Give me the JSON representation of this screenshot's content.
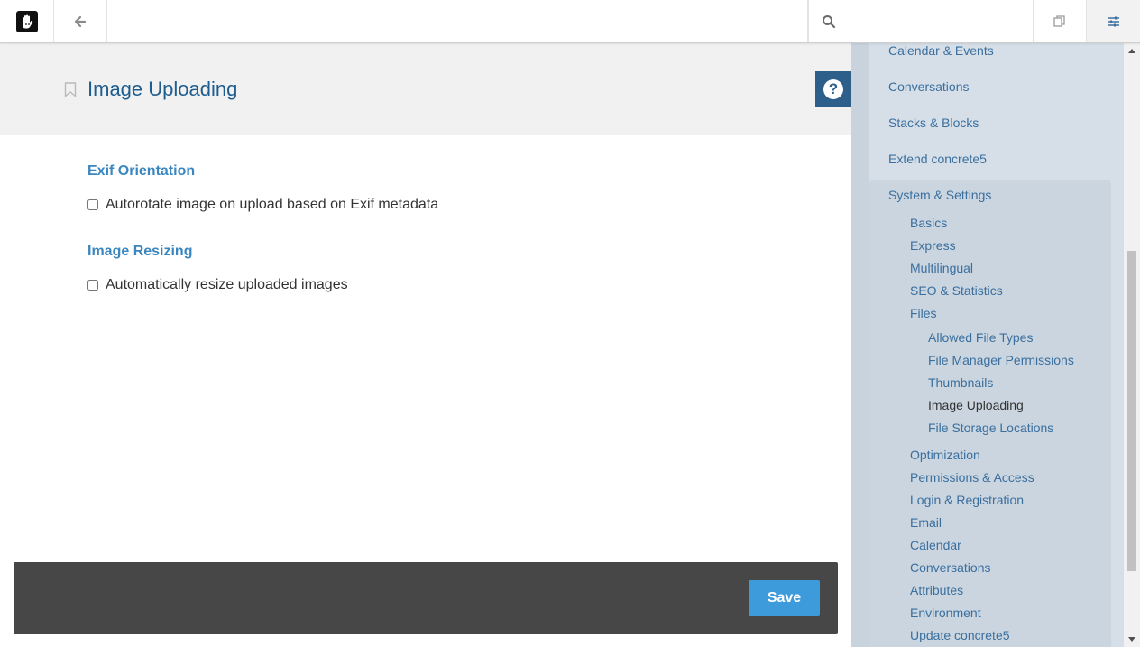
{
  "toolbar": {
    "search_placeholder": "",
    "search_value": ""
  },
  "page": {
    "title": "Image Uploading"
  },
  "sections": [
    {
      "heading": "Exif Orientation",
      "checkbox_label": "Autorotate image on upload based on Exif metadata",
      "checked": false
    },
    {
      "heading": "Image Resizing",
      "checkbox_label": "Automatically resize uploaded images",
      "checked": false
    }
  ],
  "footer": {
    "save_label": "Save"
  },
  "sidebar": {
    "top_items": [
      "Calendar & Events",
      "Conversations",
      "Stacks & Blocks",
      "Extend concrete5"
    ],
    "group_title": "System & Settings",
    "system_items": [
      "Basics",
      "Express",
      "Multilingual",
      "SEO & Statistics",
      "Files"
    ],
    "files_items": [
      "Allowed File Types",
      "File Manager Permissions",
      "Thumbnails",
      "Image Uploading",
      "File Storage Locations"
    ],
    "active_item": "Image Uploading",
    "more_items": [
      "Optimization",
      "Permissions & Access",
      "Login & Registration",
      "Email",
      "Calendar",
      "Conversations",
      "Attributes",
      "Environment",
      "Update concrete5"
    ]
  },
  "colors": {
    "title": "#1f5d8f",
    "section_heading": "#3a87c0",
    "help_button": "#2e5e8a",
    "save_button": "#3d9bdb",
    "sidebar_bg": "#d6dfe8",
    "sidebar_link": "#3a6f9e"
  }
}
